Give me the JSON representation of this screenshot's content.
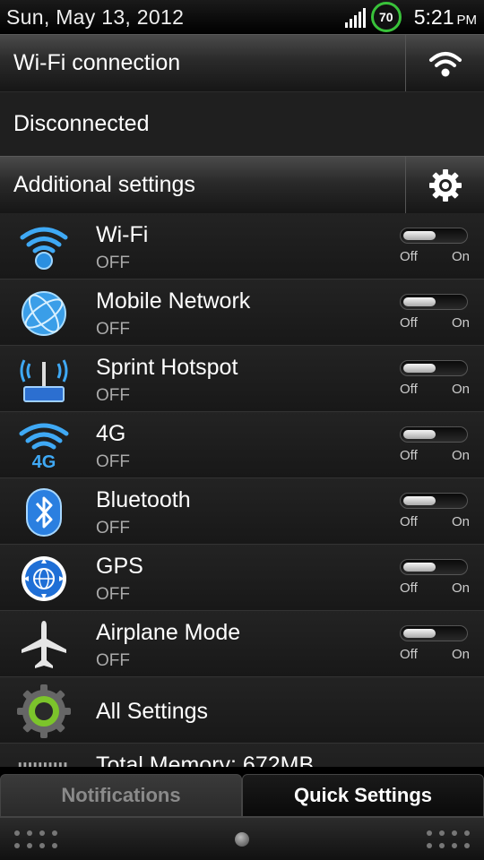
{
  "status_bar": {
    "date": "Sun, May 13, 2012",
    "battery_level": "70",
    "time": "5:21",
    "ampm": "PM",
    "battery_color": "#39c23a"
  },
  "wifi_connection": {
    "label": "Wi-Fi connection",
    "icon": "wifi-icon"
  },
  "connection_status": "Disconnected",
  "additional_settings": {
    "label": "Additional settings",
    "icon": "gear-icon"
  },
  "toggle_labels": {
    "off": "Off",
    "on": "On"
  },
  "items": [
    {
      "name": "Wi-Fi",
      "state": "OFF",
      "icon": "wifi-icon"
    },
    {
      "name": "Mobile Network",
      "state": "OFF",
      "icon": "globe-icon"
    },
    {
      "name": "Sprint Hotspot",
      "state": "OFF",
      "icon": "hotspot-icon"
    },
    {
      "name": "4G",
      "state": "OFF",
      "icon": "4g-icon"
    },
    {
      "name": "Bluetooth",
      "state": "OFF",
      "icon": "bluetooth-icon"
    },
    {
      "name": "GPS",
      "state": "OFF",
      "icon": "gps-icon"
    },
    {
      "name": "Airplane Mode",
      "state": "OFF",
      "icon": "airplane-icon"
    }
  ],
  "all_settings": {
    "name": "All Settings",
    "icon": "settings-gear-icon"
  },
  "memory": {
    "name": "Total Memory: 672MB",
    "icon": "memory-icon"
  },
  "tabs": {
    "notifications": "Notifications",
    "quick_settings": "Quick Settings",
    "active": "Quick Settings"
  }
}
